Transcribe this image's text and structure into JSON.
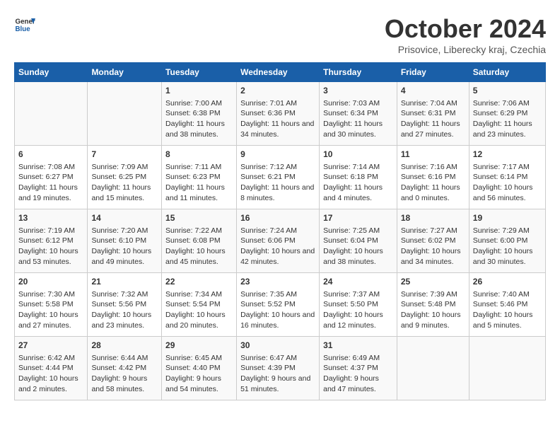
{
  "header": {
    "logo_line1": "General",
    "logo_line2": "Blue",
    "month": "October 2024",
    "location": "Prisovice, Liberecky kraj, Czechia"
  },
  "weekdays": [
    "Sunday",
    "Monday",
    "Tuesday",
    "Wednesday",
    "Thursday",
    "Friday",
    "Saturday"
  ],
  "weeks": [
    [
      {
        "day": "",
        "info": ""
      },
      {
        "day": "",
        "info": ""
      },
      {
        "day": "1",
        "info": "Sunrise: 7:00 AM\nSunset: 6:38 PM\nDaylight: 11 hours and 38 minutes."
      },
      {
        "day": "2",
        "info": "Sunrise: 7:01 AM\nSunset: 6:36 PM\nDaylight: 11 hours and 34 minutes."
      },
      {
        "day": "3",
        "info": "Sunrise: 7:03 AM\nSunset: 6:34 PM\nDaylight: 11 hours and 30 minutes."
      },
      {
        "day": "4",
        "info": "Sunrise: 7:04 AM\nSunset: 6:31 PM\nDaylight: 11 hours and 27 minutes."
      },
      {
        "day": "5",
        "info": "Sunrise: 7:06 AM\nSunset: 6:29 PM\nDaylight: 11 hours and 23 minutes."
      }
    ],
    [
      {
        "day": "6",
        "info": "Sunrise: 7:08 AM\nSunset: 6:27 PM\nDaylight: 11 hours and 19 minutes."
      },
      {
        "day": "7",
        "info": "Sunrise: 7:09 AM\nSunset: 6:25 PM\nDaylight: 11 hours and 15 minutes."
      },
      {
        "day": "8",
        "info": "Sunrise: 7:11 AM\nSunset: 6:23 PM\nDaylight: 11 hours and 11 minutes."
      },
      {
        "day": "9",
        "info": "Sunrise: 7:12 AM\nSunset: 6:21 PM\nDaylight: 11 hours and 8 minutes."
      },
      {
        "day": "10",
        "info": "Sunrise: 7:14 AM\nSunset: 6:18 PM\nDaylight: 11 hours and 4 minutes."
      },
      {
        "day": "11",
        "info": "Sunrise: 7:16 AM\nSunset: 6:16 PM\nDaylight: 11 hours and 0 minutes."
      },
      {
        "day": "12",
        "info": "Sunrise: 7:17 AM\nSunset: 6:14 PM\nDaylight: 10 hours and 56 minutes."
      }
    ],
    [
      {
        "day": "13",
        "info": "Sunrise: 7:19 AM\nSunset: 6:12 PM\nDaylight: 10 hours and 53 minutes."
      },
      {
        "day": "14",
        "info": "Sunrise: 7:20 AM\nSunset: 6:10 PM\nDaylight: 10 hours and 49 minutes."
      },
      {
        "day": "15",
        "info": "Sunrise: 7:22 AM\nSunset: 6:08 PM\nDaylight: 10 hours and 45 minutes."
      },
      {
        "day": "16",
        "info": "Sunrise: 7:24 AM\nSunset: 6:06 PM\nDaylight: 10 hours and 42 minutes."
      },
      {
        "day": "17",
        "info": "Sunrise: 7:25 AM\nSunset: 6:04 PM\nDaylight: 10 hours and 38 minutes."
      },
      {
        "day": "18",
        "info": "Sunrise: 7:27 AM\nSunset: 6:02 PM\nDaylight: 10 hours and 34 minutes."
      },
      {
        "day": "19",
        "info": "Sunrise: 7:29 AM\nSunset: 6:00 PM\nDaylight: 10 hours and 30 minutes."
      }
    ],
    [
      {
        "day": "20",
        "info": "Sunrise: 7:30 AM\nSunset: 5:58 PM\nDaylight: 10 hours and 27 minutes."
      },
      {
        "day": "21",
        "info": "Sunrise: 7:32 AM\nSunset: 5:56 PM\nDaylight: 10 hours and 23 minutes."
      },
      {
        "day": "22",
        "info": "Sunrise: 7:34 AM\nSunset: 5:54 PM\nDaylight: 10 hours and 20 minutes."
      },
      {
        "day": "23",
        "info": "Sunrise: 7:35 AM\nSunset: 5:52 PM\nDaylight: 10 hours and 16 minutes."
      },
      {
        "day": "24",
        "info": "Sunrise: 7:37 AM\nSunset: 5:50 PM\nDaylight: 10 hours and 12 minutes."
      },
      {
        "day": "25",
        "info": "Sunrise: 7:39 AM\nSunset: 5:48 PM\nDaylight: 10 hours and 9 minutes."
      },
      {
        "day": "26",
        "info": "Sunrise: 7:40 AM\nSunset: 5:46 PM\nDaylight: 10 hours and 5 minutes."
      }
    ],
    [
      {
        "day": "27",
        "info": "Sunrise: 6:42 AM\nSunset: 4:44 PM\nDaylight: 10 hours and 2 minutes."
      },
      {
        "day": "28",
        "info": "Sunrise: 6:44 AM\nSunset: 4:42 PM\nDaylight: 9 hours and 58 minutes."
      },
      {
        "day": "29",
        "info": "Sunrise: 6:45 AM\nSunset: 4:40 PM\nDaylight: 9 hours and 54 minutes."
      },
      {
        "day": "30",
        "info": "Sunrise: 6:47 AM\nSunset: 4:39 PM\nDaylight: 9 hours and 51 minutes."
      },
      {
        "day": "31",
        "info": "Sunrise: 6:49 AM\nSunset: 4:37 PM\nDaylight: 9 hours and 47 minutes."
      },
      {
        "day": "",
        "info": ""
      },
      {
        "day": "",
        "info": ""
      }
    ]
  ]
}
